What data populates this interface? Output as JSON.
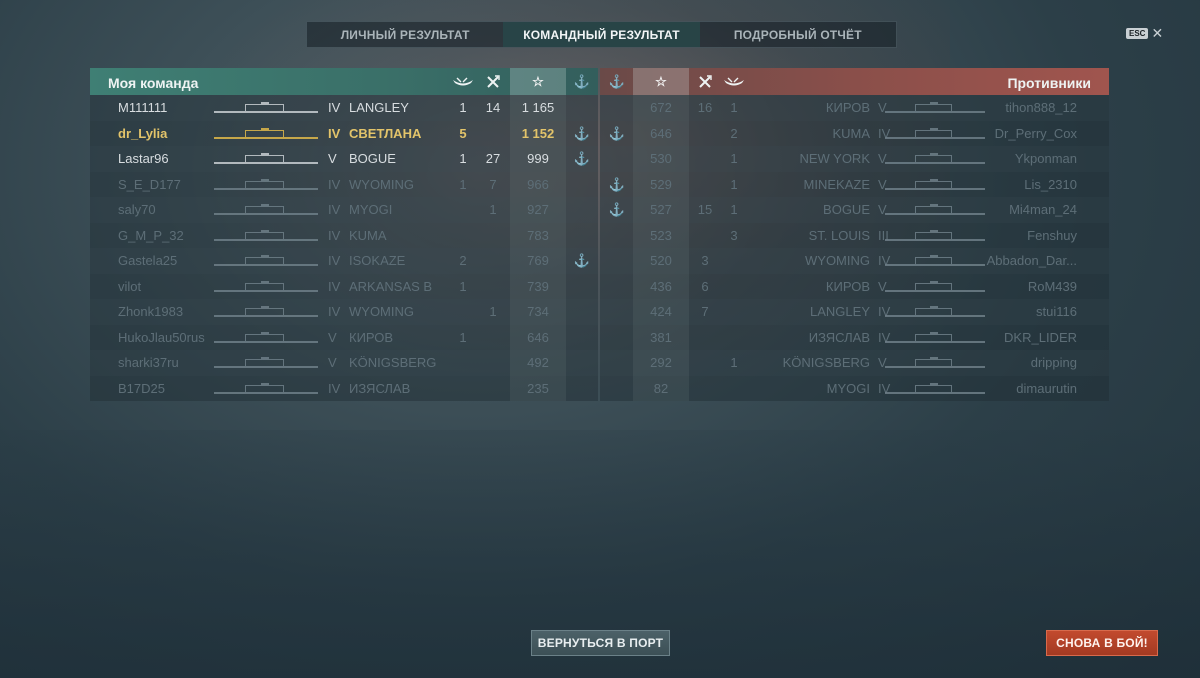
{
  "tabs": [
    {
      "label": "ЛИЧНЫЙ РЕЗУЛЬТАТ",
      "active": false
    },
    {
      "label": "КОМАНДНЫЙ РЕЗУЛЬТАТ",
      "active": true
    },
    {
      "label": "ПОДРОБНЫЙ ОТЧЁТ",
      "active": false
    }
  ],
  "esc": {
    "label": "ESC",
    "close": "✕"
  },
  "my_team": {
    "title": "Моя команда",
    "header_icons": [
      "ship-kill-icon",
      "plane-kill-icon",
      "star-icon",
      "anchor-icon"
    ],
    "rows": [
      {
        "player": "M111111",
        "tier": "IV",
        "ship": "LANGLEY",
        "ships_sunk": "1",
        "planes": "14",
        "xp": "1 165",
        "anchor": false,
        "style": "bright"
      },
      {
        "player": "dr_Lylia",
        "tier": "IV",
        "ship": "СВЕТЛАНА",
        "ships_sunk": "5",
        "planes": "",
        "xp": "1 152",
        "anchor": true,
        "style": "me"
      },
      {
        "player": "Lastar96",
        "tier": "V",
        "ship": "BOGUE",
        "ships_sunk": "1",
        "planes": "27",
        "xp": "999",
        "anchor": true,
        "style": "bright"
      },
      {
        "player": "S_E_D177",
        "tier": "IV",
        "ship": "WYOMING",
        "ships_sunk": "1",
        "planes": "7",
        "xp": "966",
        "anchor": false,
        "style": "dim"
      },
      {
        "player": "saly70",
        "tier": "IV",
        "ship": "MYOGI",
        "ships_sunk": "",
        "planes": "1",
        "xp": "927",
        "anchor": false,
        "style": "dim"
      },
      {
        "player": "G_M_P_32",
        "tier": "IV",
        "ship": "KUMA",
        "ships_sunk": "",
        "planes": "",
        "xp": "783",
        "anchor": false,
        "style": "dim"
      },
      {
        "player": "Gastela25",
        "tier": "IV",
        "ship": "ISOKAZE",
        "ships_sunk": "2",
        "planes": "",
        "xp": "769",
        "anchor": true,
        "style": "dim"
      },
      {
        "player": "vilot",
        "tier": "IV",
        "ship": "ARKANSAS B",
        "ships_sunk": "1",
        "planes": "",
        "xp": "739",
        "anchor": false,
        "style": "dim"
      },
      {
        "player": "Zhonk1983",
        "tier": "IV",
        "ship": "WYOMING",
        "ships_sunk": "",
        "planes": "1",
        "xp": "734",
        "anchor": false,
        "style": "dim"
      },
      {
        "player": "HukoJlau50rus",
        "tier": "V",
        "ship": "КИРОВ",
        "ships_sunk": "1",
        "planes": "",
        "xp": "646",
        "anchor": false,
        "style": "dim"
      },
      {
        "player": "sharki37ru",
        "tier": "V",
        "ship": "KÖNIGSBERG",
        "ships_sunk": "",
        "planes": "",
        "xp": "492",
        "anchor": false,
        "style": "dim"
      },
      {
        "player": "B17D25",
        "tier": "IV",
        "ship": "ИЗЯСЛАВ",
        "ships_sunk": "",
        "planes": "",
        "xp": "235",
        "anchor": false,
        "style": "dim"
      }
    ]
  },
  "enemy_team": {
    "title": "Противники",
    "header_icons": [
      "anchor-icon",
      "star-icon",
      "plane-kill-icon",
      "ship-kill-icon"
    ],
    "rows": [
      {
        "player": "tihon888_12",
        "tier": "V",
        "ship": "КИРОВ",
        "ships_sunk": "1",
        "planes": "16",
        "xp": "672",
        "anchor": false,
        "style": "dim"
      },
      {
        "player": "Dr_Perry_Cox",
        "tier": "IV",
        "ship": "KUMA",
        "ships_sunk": "2",
        "planes": "",
        "xp": "646",
        "anchor": true,
        "style": "dim"
      },
      {
        "player": "Ykponman",
        "tier": "V",
        "ship": "NEW YORK",
        "ships_sunk": "1",
        "planes": "",
        "xp": "530",
        "anchor": false,
        "style": "dim"
      },
      {
        "player": "Lis_2310",
        "tier": "V",
        "ship": "MINEKAZE",
        "ships_sunk": "1",
        "planes": "",
        "xp": "529",
        "anchor": true,
        "style": "dim"
      },
      {
        "player": "Mi4man_24",
        "tier": "V",
        "ship": "BOGUE",
        "ships_sunk": "1",
        "planes": "15",
        "xp": "527",
        "anchor": true,
        "style": "dim"
      },
      {
        "player": "Fenshuy",
        "tier": "III",
        "ship": "ST. LOUIS",
        "ships_sunk": "3",
        "planes": "",
        "xp": "523",
        "anchor": false,
        "style": "dim"
      },
      {
        "player": "Abbadon_Dar...",
        "tier": "IV",
        "ship": "WYOMING",
        "ships_sunk": "",
        "planes": "3",
        "xp": "520",
        "anchor": false,
        "style": "dim"
      },
      {
        "player": "RoM439",
        "tier": "V",
        "ship": "КИРОВ",
        "ships_sunk": "",
        "planes": "6",
        "xp": "436",
        "anchor": false,
        "style": "dim"
      },
      {
        "player": "stui116",
        "tier": "IV",
        "ship": "LANGLEY",
        "ships_sunk": "",
        "planes": "7",
        "xp": "424",
        "anchor": false,
        "style": "dim"
      },
      {
        "player": "DKR_LIDER",
        "tier": "IV",
        "ship": "ИЗЯСЛАВ",
        "ships_sunk": "",
        "planes": "",
        "xp": "381",
        "anchor": false,
        "style": "dim"
      },
      {
        "player": "dripping",
        "tier": "V",
        "ship": "KÖNIGSBERG",
        "ships_sunk": "1",
        "planes": "",
        "xp": "292",
        "anchor": false,
        "style": "dim"
      },
      {
        "player": "dimaurutin",
        "tier": "IV",
        "ship": "MYOGI",
        "ships_sunk": "",
        "planes": "",
        "xp": "82",
        "anchor": false,
        "style": "dim"
      }
    ]
  },
  "buttons": {
    "return_port": "ВЕРНУТЬСЯ В ПОРТ",
    "battle_again": "СНОВА В БОЙ!"
  },
  "colors": {
    "my_team_header": "#3f7f74",
    "enemy_header": "#a0554e",
    "highlight_player": "#e3c46a",
    "battle_button": "#c24a2e"
  }
}
